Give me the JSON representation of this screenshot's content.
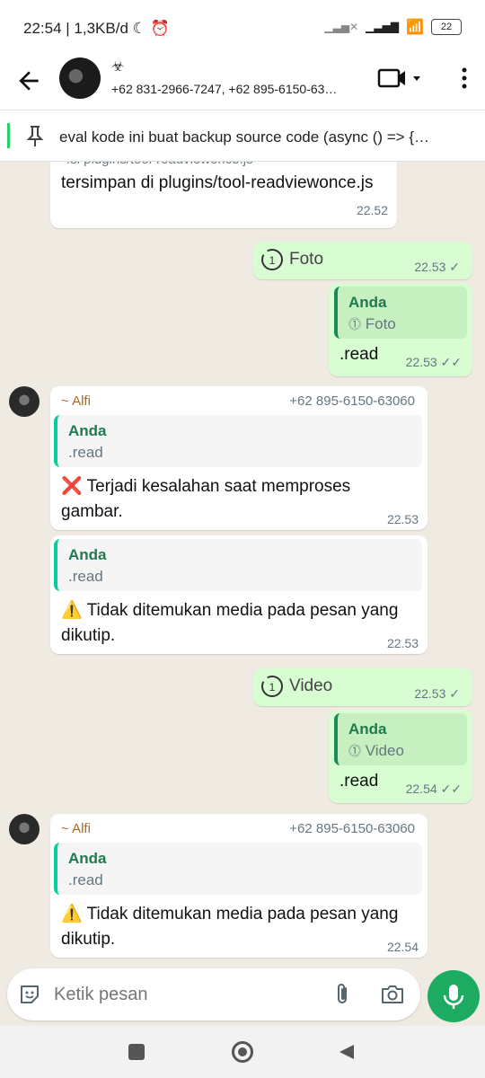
{
  "status_bar": {
    "time": "22:54",
    "net_speed": "1,3KB/d",
    "battery": "22"
  },
  "header": {
    "chat_icon": "☣",
    "participants": "+62 831-2966-7247, +62 895-6150-63…"
  },
  "pinned": {
    "text": "eval kode ini buat backup source code (async () => {…"
  },
  "messages": {
    "m1": {
      "partial": ".si plugins/tool-readviewonce.js",
      "text": "tersimpan di plugins/tool-readviewonce.js",
      "time": "22.52"
    },
    "m2": {
      "label": "Foto",
      "time": "22.53 ✓"
    },
    "m3": {
      "quote_author": "Anda",
      "quote_text": "Foto",
      "text": ".read",
      "time": "22.53 ✓✓"
    },
    "m4": {
      "sender": "~ Alfi",
      "phone": "+62 895-6150-63060",
      "quote_author": "Anda",
      "quote_text": ".read",
      "text": "❌ Terjadi kesalahan saat memproses gambar.",
      "time": "22.53"
    },
    "m5": {
      "quote_author": "Anda",
      "quote_text": ".read",
      "text": "⚠️ Tidak ditemukan media pada pesan yang dikutip.",
      "time": "22.53"
    },
    "m6": {
      "label": "Video",
      "time": "22.53 ✓"
    },
    "m7": {
      "quote_author": "Anda",
      "quote_text": "Video",
      "text": ".read",
      "time": "22.54 ✓✓"
    },
    "m8": {
      "sender": "~ Alfi",
      "phone": "+62 895-6150-63060",
      "quote_author": "Anda",
      "quote_text": ".read",
      "text": "⚠️ Tidak ditemukan media pada pesan yang dikutip.",
      "time": "22.54"
    }
  },
  "input": {
    "placeholder": "Ketik pesan"
  },
  "colors": {
    "accent": "#1daa61",
    "outgoing": "#d9fdd3",
    "incoming": "#ffffff",
    "background": "#efeae2"
  }
}
